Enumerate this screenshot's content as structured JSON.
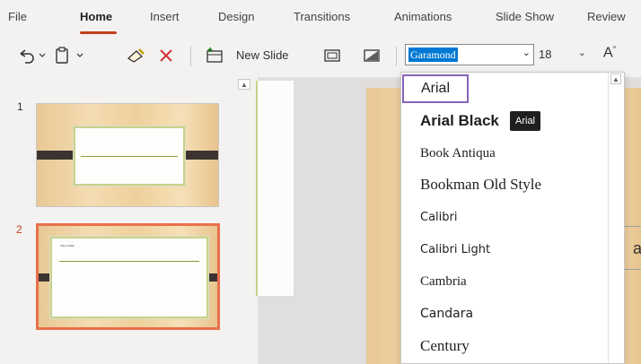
{
  "tabs": [
    "File",
    "Home",
    "Insert",
    "Design",
    "Transitions",
    "Animations",
    "Slide Show",
    "Review"
  ],
  "active_tab": "Home",
  "toolbar": {
    "new_slide_label": "New Slide",
    "font_name": "Garamond",
    "font_size": "18",
    "grow_font_label": "A"
  },
  "slides": [
    {
      "number": "1",
      "selected": false
    },
    {
      "number": "2",
      "selected": true,
      "title_text": "Title of slide"
    }
  ],
  "canvas": {
    "partial_text": "a"
  },
  "font_list": [
    {
      "name": "Arial",
      "family": "Liberation Sans",
      "weight": "normal"
    },
    {
      "name": "Arial Black",
      "family": "Liberation Sans",
      "weight": "bold"
    },
    {
      "name": "Book Antiqua",
      "family": "Liberation Serif",
      "weight": "normal"
    },
    {
      "name": "Bookman Old Style",
      "family": "Liberation Serif",
      "weight": "normal"
    },
    {
      "name": "Calibri",
      "family": "DejaVu Sans",
      "weight": "normal"
    },
    {
      "name": "Calibri Light",
      "family": "DejaVu Sans",
      "weight": "normal"
    },
    {
      "name": "Cambria",
      "family": "Liberation Serif",
      "weight": "normal"
    },
    {
      "name": "Candara",
      "family": "DejaVu Sans",
      "weight": "normal"
    },
    {
      "name": "Century",
      "family": "Liberation Serif",
      "weight": "normal"
    }
  ],
  "hovered_font": "Arial",
  "tooltip": "Arial",
  "colors": {
    "accent": "#c43e1c",
    "selection": "#8764b8",
    "highlight": "#0078d4"
  }
}
